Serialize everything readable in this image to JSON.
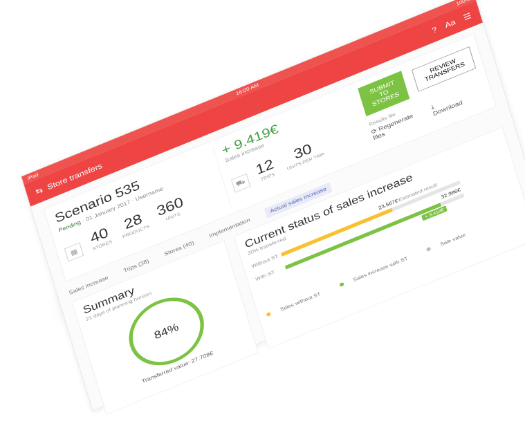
{
  "statusbar": {
    "carrier": "iPad",
    "time": "16:00 AM",
    "battery": "100%"
  },
  "appbar": {
    "title": "Store transfers"
  },
  "scenario": {
    "title": "Scenario 535",
    "badge": "Pending",
    "date": "01 January 2017",
    "user": "Username",
    "stats": [
      {
        "value": "40",
        "label": "Stores"
      },
      {
        "value": "28",
        "label": "Products"
      },
      {
        "value": "360",
        "label": "Units"
      }
    ]
  },
  "sales": {
    "value": "+ 9.419€",
    "label": "Sales increase"
  },
  "trips": {
    "value": "12",
    "label": "Trips",
    "units_value": "30",
    "units_label": "Units per trip"
  },
  "actions": {
    "submit": "Submit to stores",
    "review": "Review transfers"
  },
  "results": {
    "title": "Results file",
    "regenerate": "Regenerate files",
    "download": "Download"
  },
  "tabs": [
    "Sales increase",
    "Trips (38)",
    "Stores (40)",
    "Implementation",
    "Actual sales increase"
  ],
  "summary": {
    "title": "Summary",
    "sub": "21 days of planning horizon",
    "percent": "84%",
    "transferred": "Transferred value: 27.708€"
  },
  "status": {
    "title": "Current status of sales increase",
    "sub": "20% transferred",
    "rows": [
      {
        "label": "Without ST",
        "value": "23.567€",
        "extra": "Estimated result"
      },
      {
        "label": "With ST",
        "value": "32.986€",
        "tag": "+ 9.419€"
      }
    ],
    "legend": [
      "Sales without ST",
      "Sales increase with ST",
      "Sale value"
    ]
  },
  "chart_data": {
    "type": "bar",
    "categories": [
      "Without ST",
      "With ST"
    ],
    "values": [
      23567,
      32986
    ],
    "progress": 0.84
  }
}
